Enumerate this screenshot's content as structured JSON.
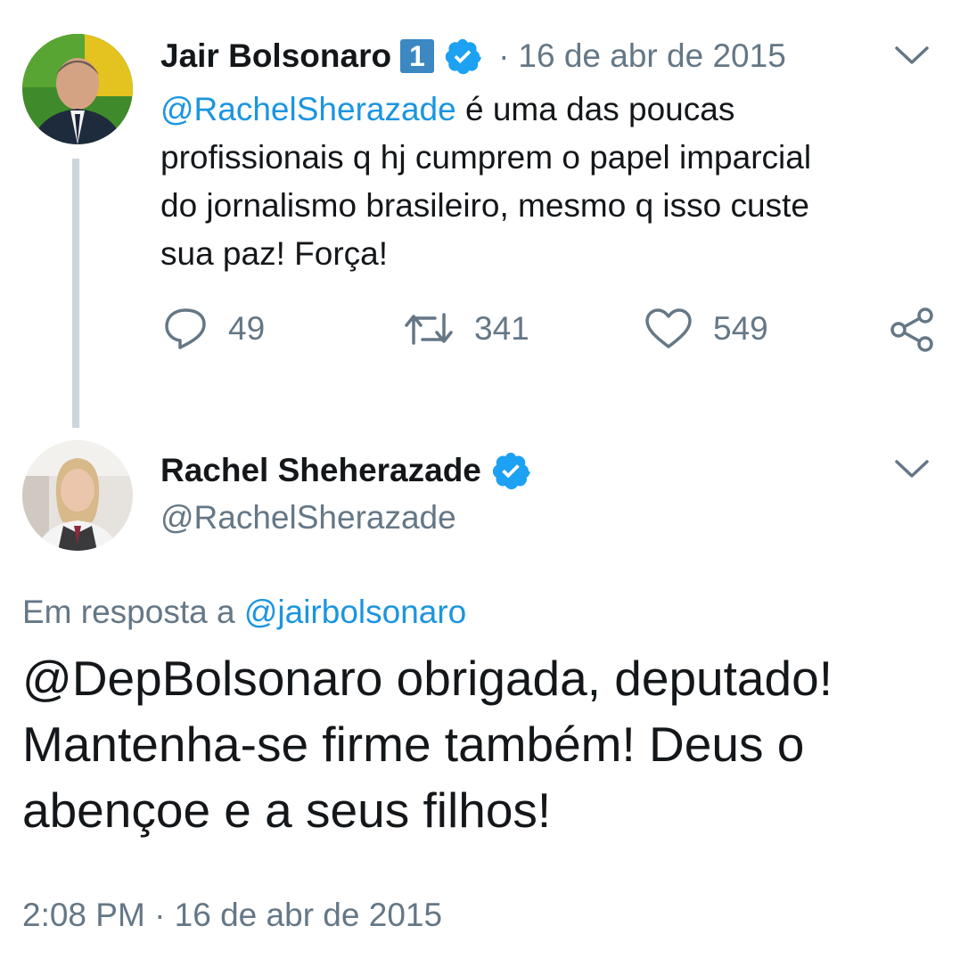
{
  "tweet1": {
    "author_name": "Jair Bolsonaro",
    "badge_number": "1",
    "separator": "·",
    "date": "16 de abr de 2015",
    "mention": "@RachelSherazade",
    "text_line1_rest": " é uma das poucas",
    "text_line2": "profissionais q hj cumprem o papel imparcial",
    "text_line3": "do jornalismo brasileiro, mesmo q isso custe",
    "text_line4": "sua paz! Força!",
    "replies": "49",
    "retweets": "341",
    "likes": "549"
  },
  "tweet2": {
    "author_name": "Rachel Sheherazade",
    "handle": "@RachelSherazade",
    "reply_prefix": "Em resposta a",
    "reply_to": "@jairbolsonaro",
    "text_line1": "@DepBolsonaro obrigada, deputado!",
    "text_line2": "Mantenha-se firme também! Deus o",
    "text_line3": "abençoe e a seus filhos!",
    "timestamp": "2:08 PM · 16 de abr de 2015"
  },
  "colors": {
    "link": "#1b95e0",
    "verified": "#1da1f2",
    "muted": "#657786",
    "thread_line": "#ccd6dd",
    "badge_bg": "#3b88c3"
  },
  "icons": [
    "reply-icon",
    "retweet-icon",
    "like-icon",
    "share-icon",
    "chevron-down-icon",
    "verified-icon"
  ]
}
